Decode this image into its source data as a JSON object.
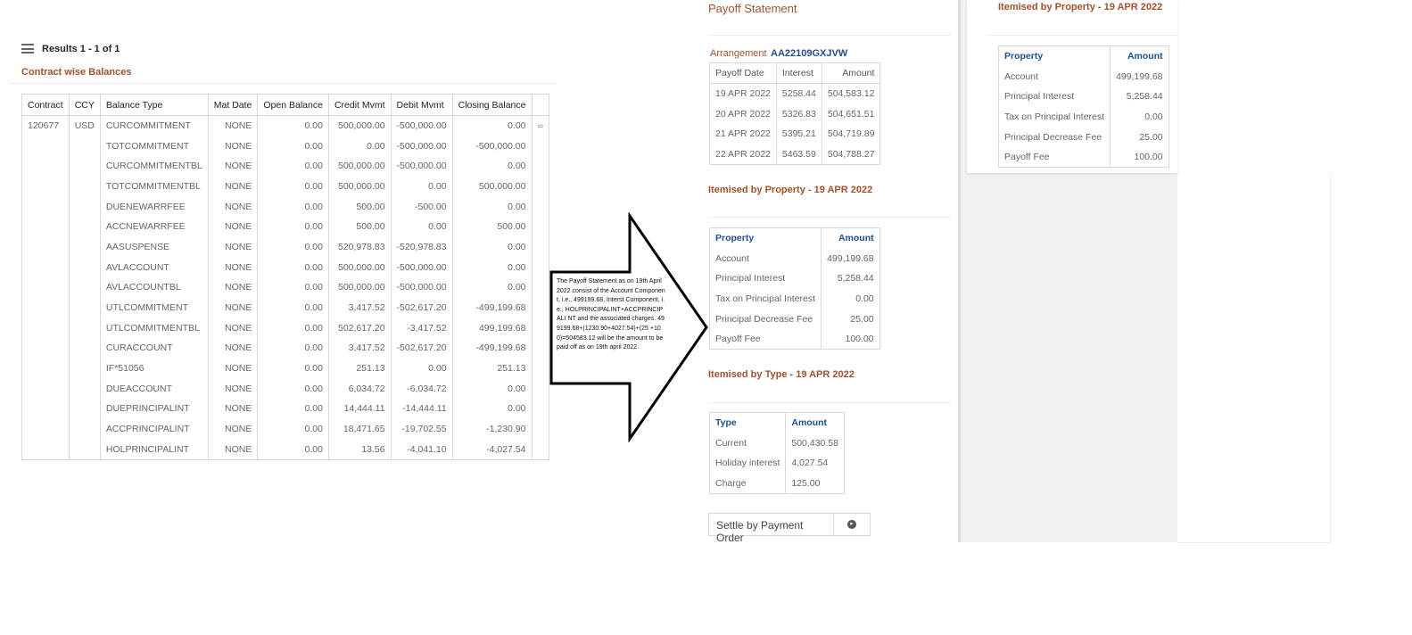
{
  "left": {
    "results_label": "Results 1 - 1 of 1",
    "section_title": "Contract wise Balances",
    "columns": [
      "Contract",
      "CCY",
      "Balance Type",
      "Mat Date",
      "Open Balance",
      "Credit Mvmt",
      "Debit Mvmt",
      "Closing Balance"
    ],
    "contract": "120677",
    "ccy": "USD",
    "rows": [
      {
        "type": "CURCOMMITMENT",
        "mat": "NONE",
        "open": "0.00",
        "credit": "500,000.00",
        "debit": "-500,000.00",
        "closing": "0.00"
      },
      {
        "type": "TOTCOMMITMENT",
        "mat": "NONE",
        "open": "0.00",
        "credit": "0.00",
        "debit": "-500,000.00",
        "closing": "-500,000.00"
      },
      {
        "type": "CURCOMMITMENTBL",
        "mat": "NONE",
        "open": "0.00",
        "credit": "500,000.00",
        "debit": "-500,000.00",
        "closing": "0.00"
      },
      {
        "type": "TOTCOMMITMENTBL",
        "mat": "NONE",
        "open": "0.00",
        "credit": "500,000.00",
        "debit": "0.00",
        "closing": "500,000.00"
      },
      {
        "type": "DUENEWARRFEE",
        "mat": "NONE",
        "open": "0.00",
        "credit": "500.00",
        "debit": "-500.00",
        "closing": "0.00"
      },
      {
        "type": "ACCNEWARRFEE",
        "mat": "NONE",
        "open": "0.00",
        "credit": "500.00",
        "debit": "0.00",
        "closing": "500.00"
      },
      {
        "type": "AASUSPENSE",
        "mat": "NONE",
        "open": "0.00",
        "credit": "520,978.83",
        "debit": "-520,978.83",
        "closing": "0.00"
      },
      {
        "type": "AVLACCOUNT",
        "mat": "NONE",
        "open": "0.00",
        "credit": "500,000.00",
        "debit": "-500,000.00",
        "closing": "0.00"
      },
      {
        "type": "AVLACCOUNTBL",
        "mat": "NONE",
        "open": "0.00",
        "credit": "500,000.00",
        "debit": "-500,000.00",
        "closing": "0.00"
      },
      {
        "type": "UTLCOMMITMENT",
        "mat": "NONE",
        "open": "0.00",
        "credit": "3,417.52",
        "debit": "-502,617.20",
        "closing": "-499,199.68"
      },
      {
        "type": "UTLCOMMITMENTBL",
        "mat": "NONE",
        "open": "0.00",
        "credit": "502,617.20",
        "debit": "-3,417.52",
        "closing": "499,199.68"
      },
      {
        "type": "CURACCOUNT",
        "mat": "NONE",
        "open": "0.00",
        "credit": "3,417.52",
        "debit": "-502,617.20",
        "closing": "-499,199.68"
      },
      {
        "type": "IF*51056",
        "mat": "NONE",
        "open": "0.00",
        "credit": "251.13",
        "debit": "0.00",
        "closing": "251.13"
      },
      {
        "type": "DUEACCOUNT",
        "mat": "NONE",
        "open": "0.00",
        "credit": "6,034.72",
        "debit": "-6,034.72",
        "closing": "0.00"
      },
      {
        "type": "DUEPRINCIPALINT",
        "mat": "NONE",
        "open": "0.00",
        "credit": "14,444.11",
        "debit": "-14,444.11",
        "closing": "0.00"
      },
      {
        "type": "ACCPRINCIPALINT",
        "mat": "NONE",
        "open": "0.00",
        "credit": "18,471.65",
        "debit": "-19,702.55",
        "closing": "-1,230.90"
      },
      {
        "type": "HOLPRINCIPALINT",
        "mat": "NONE",
        "open": "0.00",
        "credit": "13.56",
        "debit": "-4,041.10",
        "closing": "-4,027.54"
      }
    ],
    "eye_icon": "eye-icon"
  },
  "annotation": {
    "text": "The Payoff Statement as on 19th April 2022 consist of the Account Component, i.e., 499199.68, Interst Component, i.e., HOLPRINCIPALINT+ACCPRINCIPALI NT and the associated charges. 499199.68+(1230.90+4027.54)+(25 +100)=504583.12 will be the amount to be paid off as on 19th april 2022."
  },
  "payoff": {
    "title": "Payoff Statement",
    "arrangement_label": "Arrangement",
    "arrangement_value": "AA22109GXJVW",
    "dates_columns": [
      "Payoff Date",
      "Interest",
      "Amount"
    ],
    "dates": [
      {
        "date": "19 APR 2022",
        "interest": "5258.44",
        "amount": "504,583.12"
      },
      {
        "date": "20 APR 2022",
        "interest": "5326.83",
        "amount": "504,651.51"
      },
      {
        "date": "21 APR 2022",
        "interest": "5395.21",
        "amount": "504,719.89"
      },
      {
        "date": "22 APR 2022",
        "interest": "5463.59",
        "amount": "504,788.27"
      }
    ],
    "by_property_title": "Itemised by Property - 19 APR 2022",
    "property_columns": [
      "Property",
      "Amount"
    ],
    "properties": [
      {
        "name": "Account",
        "amount": "499,199.68"
      },
      {
        "name": "Principal Interest",
        "amount": "5,258.44"
      },
      {
        "name": "Tax on Principal Interest",
        "amount": "0.00"
      },
      {
        "name": "Principal Decrease Fee",
        "amount": "25.00"
      },
      {
        "name": "Payoff Fee",
        "amount": "100.00"
      }
    ],
    "by_type_title": "Itemised by Type - 19 APR 2022",
    "type_columns": [
      "Type",
      "Amount"
    ],
    "types": [
      {
        "name": "Current",
        "amount": "500,430.58"
      },
      {
        "name": "Holiday interest",
        "amount": "4,027.54"
      },
      {
        "name": "Charge",
        "amount": "125.00"
      }
    ],
    "settle_label": "Settle by Payment Order",
    "settle_icon": "arrow-right-circle-icon"
  },
  "right": {
    "title": "Itemised by Property - 19 APR 2022",
    "property_columns": [
      "Property",
      "Amount"
    ],
    "properties": [
      {
        "name": "Account",
        "amount": "499,199.68"
      },
      {
        "name": "Principal Interest",
        "amount": "5,258.44"
      },
      {
        "name": "Tax on Principal Interest",
        "amount": "0.00"
      },
      {
        "name": "Principal Decrease Fee",
        "amount": "25.00"
      },
      {
        "name": "Payoff Fee",
        "amount": "100.00"
      }
    ]
  },
  "colors": {
    "accent": "#a0522d",
    "link_blue": "#1f4f8c",
    "border": "#d9d9d9"
  }
}
